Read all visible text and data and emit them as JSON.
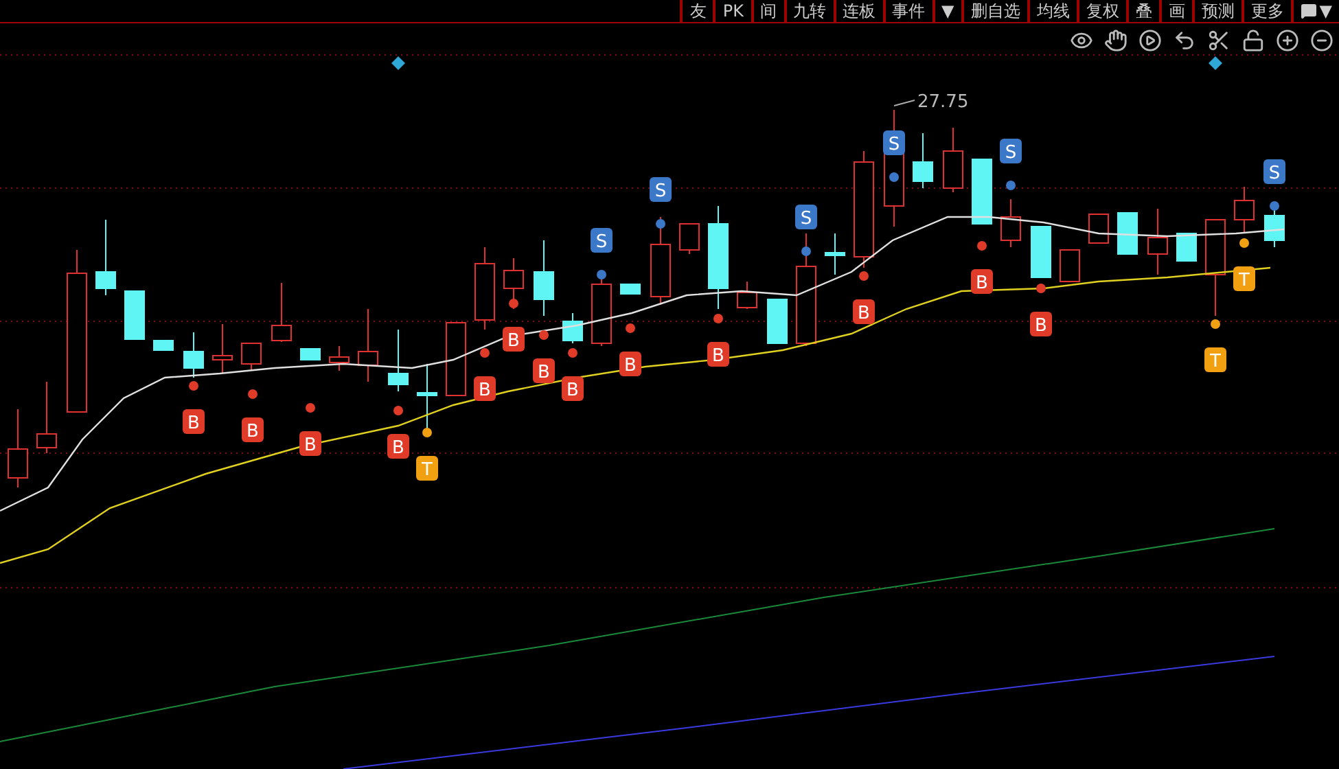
{
  "menu_bar": {
    "items": [
      {
        "label": "友"
      },
      {
        "label": "PK"
      },
      {
        "label": "间"
      },
      {
        "label": "九转"
      },
      {
        "label": "连板"
      },
      {
        "label": "事件"
      },
      {
        "label": "▼"
      },
      {
        "label": "删自选"
      },
      {
        "label": "均线"
      },
      {
        "label": "复权"
      },
      {
        "label": "叠"
      },
      {
        "label": "画"
      },
      {
        "label": "预测"
      },
      {
        "label": "更多"
      },
      {
        "label": "▼",
        "kind": "icon-dropdown"
      }
    ]
  },
  "chart": {
    "high_label": "27.75",
    "markers": [
      {
        "kind": "buy",
        "label": "B"
      },
      {
        "kind": "buy",
        "label": "B"
      },
      {
        "kind": "buy",
        "label": "B"
      },
      {
        "kind": "buy",
        "label": "B"
      },
      {
        "kind": "buy",
        "label": "B"
      },
      {
        "kind": "buy",
        "label": "B"
      },
      {
        "kind": "buy",
        "label": "B"
      },
      {
        "kind": "buy",
        "label": "B"
      },
      {
        "kind": "buy",
        "label": "B"
      },
      {
        "kind": "buy",
        "label": "B"
      },
      {
        "kind": "buy",
        "label": "B"
      },
      {
        "kind": "buy",
        "label": "B"
      },
      {
        "kind": "buy",
        "label": "B"
      },
      {
        "kind": "sell",
        "label": "S"
      },
      {
        "kind": "sell",
        "label": "S"
      },
      {
        "kind": "sell",
        "label": "S"
      },
      {
        "kind": "sell",
        "label": "S"
      },
      {
        "kind": "sell",
        "label": "S"
      },
      {
        "kind": "sell",
        "label": "S"
      },
      {
        "kind": "hold",
        "label": "T"
      },
      {
        "kind": "hold",
        "label": "T"
      },
      {
        "kind": "hold",
        "label": "T"
      }
    ]
  }
}
